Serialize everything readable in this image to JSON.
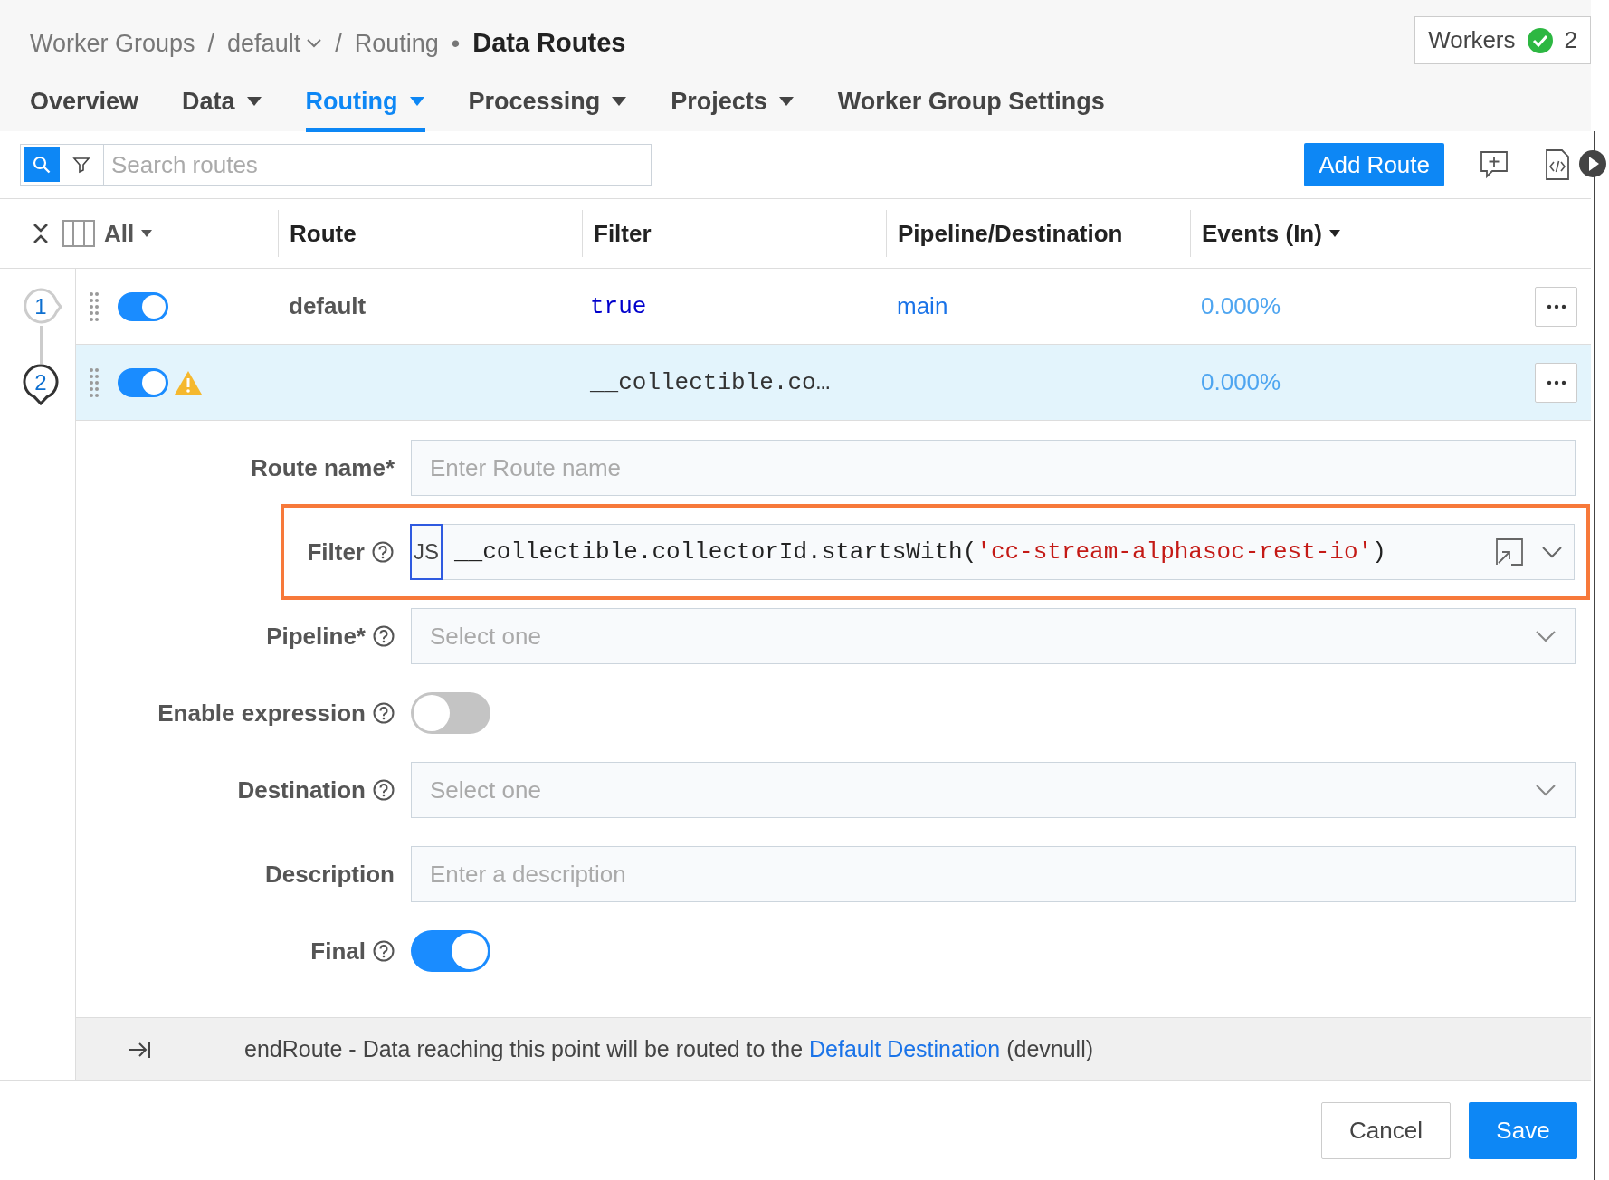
{
  "breadcrumb": [
    {
      "kind": "link",
      "label": "Worker Groups"
    },
    {
      "kind": "sep",
      "label": "/"
    },
    {
      "kind": "dropdown",
      "label": "default"
    },
    {
      "kind": "sep",
      "label": "/"
    },
    {
      "kind": "link",
      "label": "Routing"
    },
    {
      "kind": "sep",
      "label": "•"
    },
    {
      "kind": "current",
      "label": "Data Routes"
    }
  ],
  "workers": {
    "label": "Workers",
    "count": "2",
    "healthy": true
  },
  "tabs": [
    {
      "label": "Overview",
      "selected": false,
      "dropdown": false
    },
    {
      "label": "Data",
      "selected": false,
      "dropdown": true
    },
    {
      "label": "Routing",
      "selected": true,
      "dropdown": true
    },
    {
      "label": "Processing",
      "selected": false,
      "dropdown": true
    },
    {
      "label": "Projects",
      "selected": false,
      "dropdown": true
    },
    {
      "label": "Worker Group Settings",
      "selected": false,
      "dropdown": false
    }
  ],
  "search": {
    "placeholder": "Search routes"
  },
  "add_button": "Add Route",
  "table": {
    "selector": "All",
    "columns": [
      "Route",
      "Filter",
      "Pipeline/Destination",
      "Events (In)"
    ],
    "rows": [
      {
        "number": "1",
        "selected": false,
        "enabled": true,
        "warning": false,
        "route": "default",
        "filter": "true",
        "destination": "main",
        "events": "0.000%"
      },
      {
        "number": "2",
        "selected": true,
        "enabled": true,
        "warning": true,
        "filter": "__collectible.co…",
        "events": "0.000%"
      }
    ]
  },
  "form": [
    {
      "kind": "text",
      "label": "Route name*",
      "placeholder": "Enter Route name"
    },
    {
      "kind": "code",
      "label": "Filter",
      "help": true,
      "highlighted": true,
      "language": "JS",
      "code": "__collectible.collectorId.startsWith(",
      "string": "'cc-stream-alphasoc-rest-io'",
      "code_end": ")"
    },
    {
      "kind": "select",
      "label": "Pipeline*",
      "help": true,
      "placeholder": "Select one"
    },
    {
      "kind": "toggle",
      "label": "Enable expression",
      "help": true,
      "on": false
    },
    {
      "kind": "select",
      "label": "Destination",
      "help": true,
      "placeholder": "Select one"
    },
    {
      "kind": "text",
      "label": "Description",
      "placeholder": "Enter a description"
    },
    {
      "kind": "toggle",
      "label": "Final",
      "help": true,
      "on": true
    }
  ],
  "end_route": {
    "text": "endRoute - Data reaching this point will be routed to the ",
    "link": "Default Destination",
    "suffix": " (devnull)"
  },
  "buttons": [
    {
      "kind": "secondary",
      "label": "Cancel"
    },
    {
      "kind": "primary",
      "label": "Save"
    }
  ]
}
